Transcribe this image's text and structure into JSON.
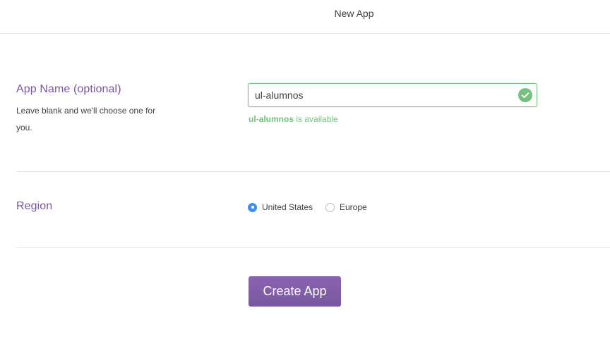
{
  "header": {
    "title": "New App"
  },
  "app_name": {
    "title": "App Name (optional)",
    "help": "Leave blank and we'll choose one for you.",
    "value": "ul-alumnos",
    "status_icon": "check-circle-icon",
    "availability_name": "ul-alumnos",
    "availability_suffix": " is available"
  },
  "region": {
    "title": "Region",
    "options": [
      {
        "label": "United States",
        "selected": true
      },
      {
        "label": "Europe",
        "selected": false
      }
    ]
  },
  "actions": {
    "create_label": "Create App"
  },
  "colors": {
    "accent": "#79589f",
    "success": "#74c080",
    "radio_selected": "#408fec"
  }
}
